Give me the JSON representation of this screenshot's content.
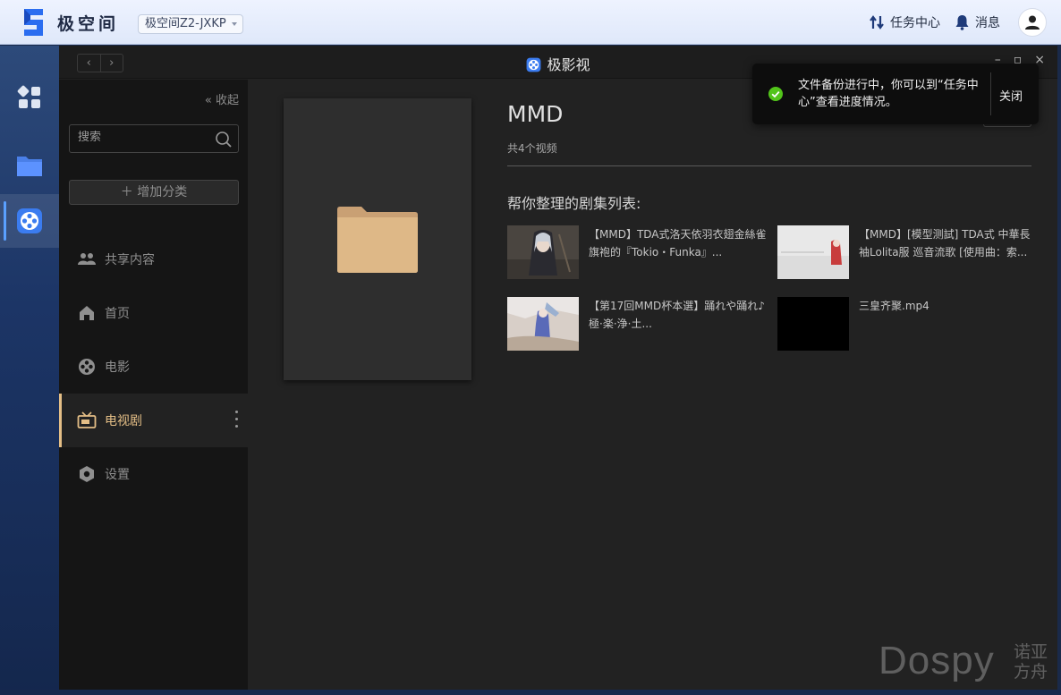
{
  "topbar": {
    "brand": "极空间",
    "device": "极空间Z2-JXKP",
    "task_center": "任务中心",
    "messages": "消息"
  },
  "app": {
    "title": "极影视",
    "collapse_label": "收起",
    "search_placeholder": "搜索",
    "add_category": "增加分类",
    "nav": [
      {
        "label": "共享内容",
        "icon": "people-icon"
      },
      {
        "label": "首页",
        "icon": "home-icon"
      },
      {
        "label": "电影",
        "icon": "film-reel-icon"
      },
      {
        "label": "电视剧",
        "icon": "tv-icon",
        "active": true
      },
      {
        "label": "设置",
        "icon": "settings-hex-icon"
      }
    ]
  },
  "show": {
    "title": "MMD",
    "count": "共4个视频",
    "section_title": "帮你整理的剧集列表:",
    "episodes": [
      {
        "title": "【MMD】TDA式洛天依羽衣翅金絲雀旗袍的『Tokio・Funka』..."
      },
      {
        "title": "【MMD】[模型测試] TDA式 中華長袖Lolita服 巡音流歌 [使用曲：索..."
      },
      {
        "title": "【第17回MMD杯本選】踊れや踊れ♪極·楽·浄·土..."
      },
      {
        "title": "三皇齐聚.mp4"
      }
    ]
  },
  "toast": {
    "message": "文件备份进行中，你可以到“任务中心”查看进度情况。",
    "close": "关闭"
  },
  "watermark": {
    "text": "Dospy",
    "cn": "诺亚方舟"
  },
  "colors": {
    "accent": "#e4be86",
    "success": "#52c41a",
    "rail": "#1c3566"
  }
}
